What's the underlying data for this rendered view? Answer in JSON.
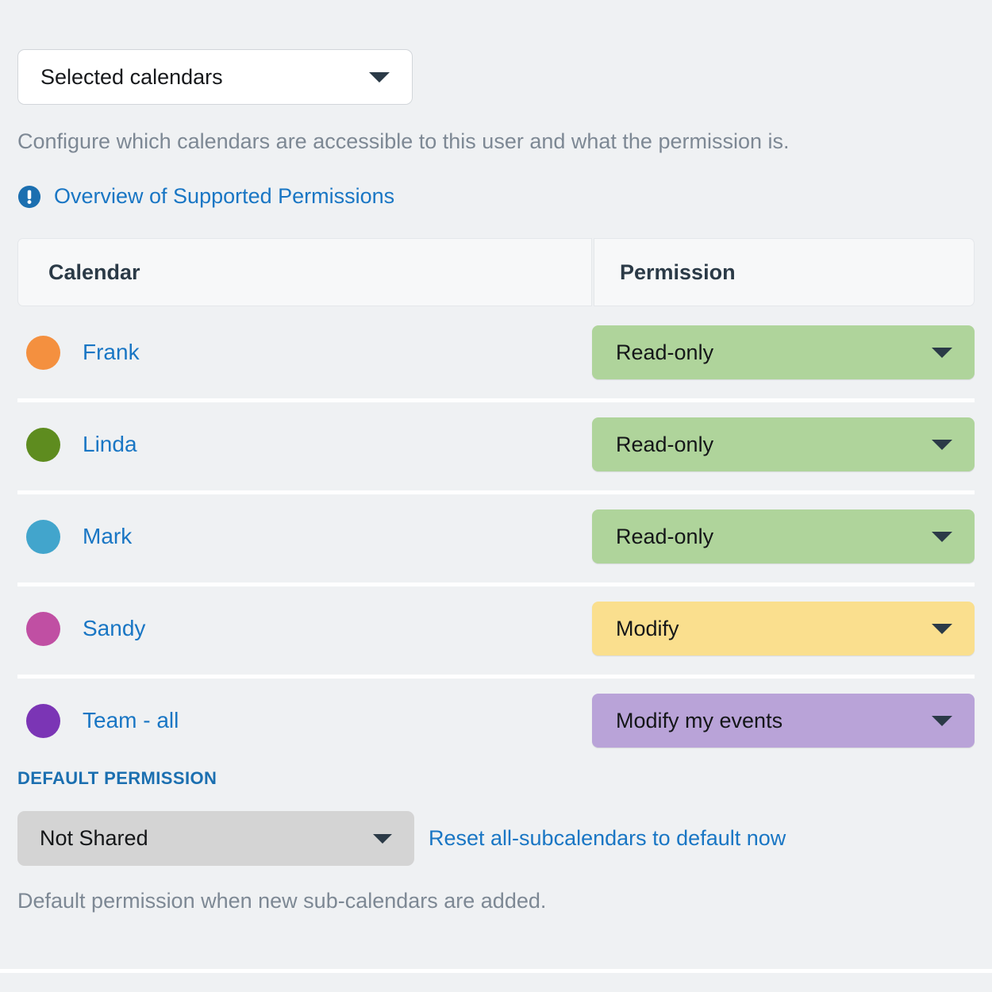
{
  "scope_select": {
    "value": "Selected calendars",
    "caret_icon": "chevron-down-icon"
  },
  "description": "Configure which calendars are accessible to this user and what the permission is.",
  "info_link": {
    "icon": "exclamation-circle-icon",
    "text": "Overview of Supported Permissions"
  },
  "table": {
    "headers": {
      "calendar": "Calendar",
      "permission": "Permission"
    },
    "rows": [
      {
        "name": "Frank",
        "dot_color": "#f4903f",
        "permission": "Read-only",
        "permission_color": "#afd49b"
      },
      {
        "name": "Linda",
        "dot_color": "#5e8c1f",
        "permission": "Read-only",
        "permission_color": "#afd49b"
      },
      {
        "name": "Mark",
        "dot_color": "#42a5cc",
        "permission": "Read-only",
        "permission_color": "#afd49b"
      },
      {
        "name": "Sandy",
        "dot_color": "#c04fa3",
        "permission": "Modify",
        "permission_color": "#fadf8e"
      },
      {
        "name": "Team - all",
        "dot_color": "#7b35b5",
        "permission": "Modify my events",
        "permission_color": "#b9a3d8"
      }
    ]
  },
  "default_permission": {
    "label": "DEFAULT PERMISSION",
    "value": "Not Shared",
    "reset_link": "Reset all-subcalendars to default now",
    "note": "Default permission when new sub-calendars are added."
  },
  "colors": {
    "page_background": "#eff1f3",
    "link": "#1976c4",
    "muted_text": "#7d8894",
    "heading_text": "#2b3a47",
    "accent_blue": "#1b6fb0"
  }
}
